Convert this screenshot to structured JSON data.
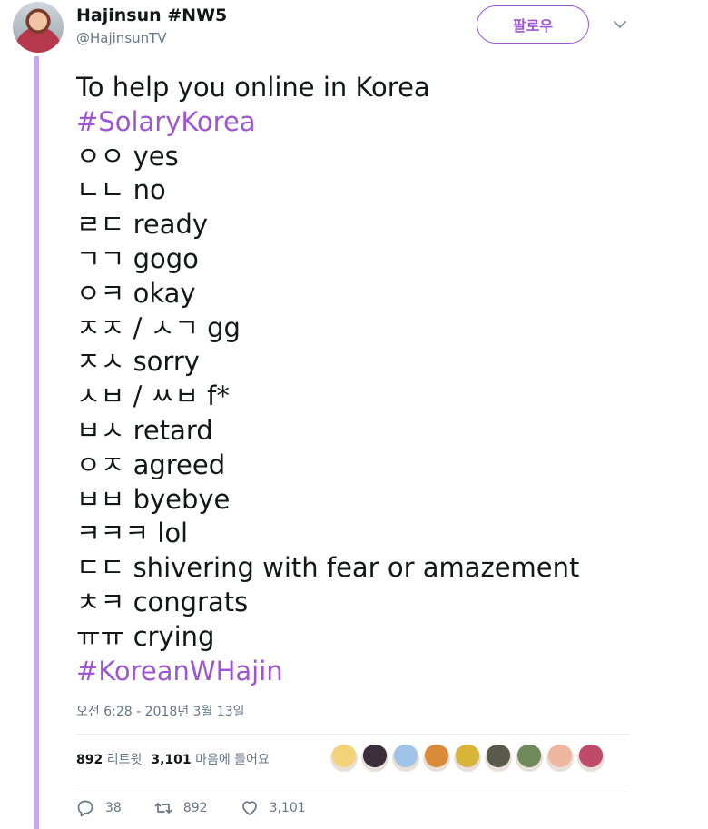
{
  "author": {
    "display_name": "Hajinsun #NW5",
    "handle": "@HajinsunTV"
  },
  "follow_button_label": "팔로우",
  "tweet": {
    "lines": [
      {
        "text": "To help you online in Korea",
        "hashtag": false
      },
      {
        "text": "#SolaryKorea",
        "hashtag": true
      },
      {
        "text": "ㅇㅇ yes",
        "hashtag": false
      },
      {
        "text": "ㄴㄴ no",
        "hashtag": false
      },
      {
        "text": "ㄹㄷ ready",
        "hashtag": false
      },
      {
        "text": "ㄱㄱ gogo",
        "hashtag": false
      },
      {
        "text": "ㅇㅋ okay",
        "hashtag": false
      },
      {
        "text": "ㅈㅈ / ㅅㄱ gg",
        "hashtag": false
      },
      {
        "text": "ㅈㅅ sorry",
        "hashtag": false
      },
      {
        "text": "ㅅㅂ / ㅆㅂ f*",
        "hashtag": false
      },
      {
        "text": "ㅂㅅ retard",
        "hashtag": false
      },
      {
        "text": "ㅇㅈ agreed",
        "hashtag": false
      },
      {
        "text": "ㅂㅂ byebye",
        "hashtag": false
      },
      {
        "text": "ㅋㅋㅋ lol",
        "hashtag": false
      },
      {
        "text": "ㄷㄷ shivering with fear or amazement",
        "hashtag": false
      },
      {
        "text": "ㅊㅋ congrats",
        "hashtag": false
      },
      {
        "text": "ㅠㅠ crying",
        "hashtag": false
      },
      {
        "text": "#KoreanWHajin",
        "hashtag": true
      }
    ]
  },
  "timestamp": "오전 6:28 - 2018년 3월 13일",
  "stats": {
    "retweets_count": "892",
    "retweets_label": "리트윗",
    "likes_count": "3,101",
    "likes_label": "마음에 들어요"
  },
  "liker_avatar_colors": [
    "#f2d37a",
    "#3a2f3a",
    "#9fc4e8",
    "#d98b3a",
    "#d6b53a",
    "#5a5a4a",
    "#6f8a5a",
    "#f0b7a0",
    "#c04a6a"
  ],
  "actions": {
    "reply_count": "38",
    "retweet_count": "892",
    "like_count": "3,101"
  },
  "colors": {
    "accent": "#9d57d3",
    "thread_line": "#c9a7eb",
    "muted": "#657786"
  }
}
